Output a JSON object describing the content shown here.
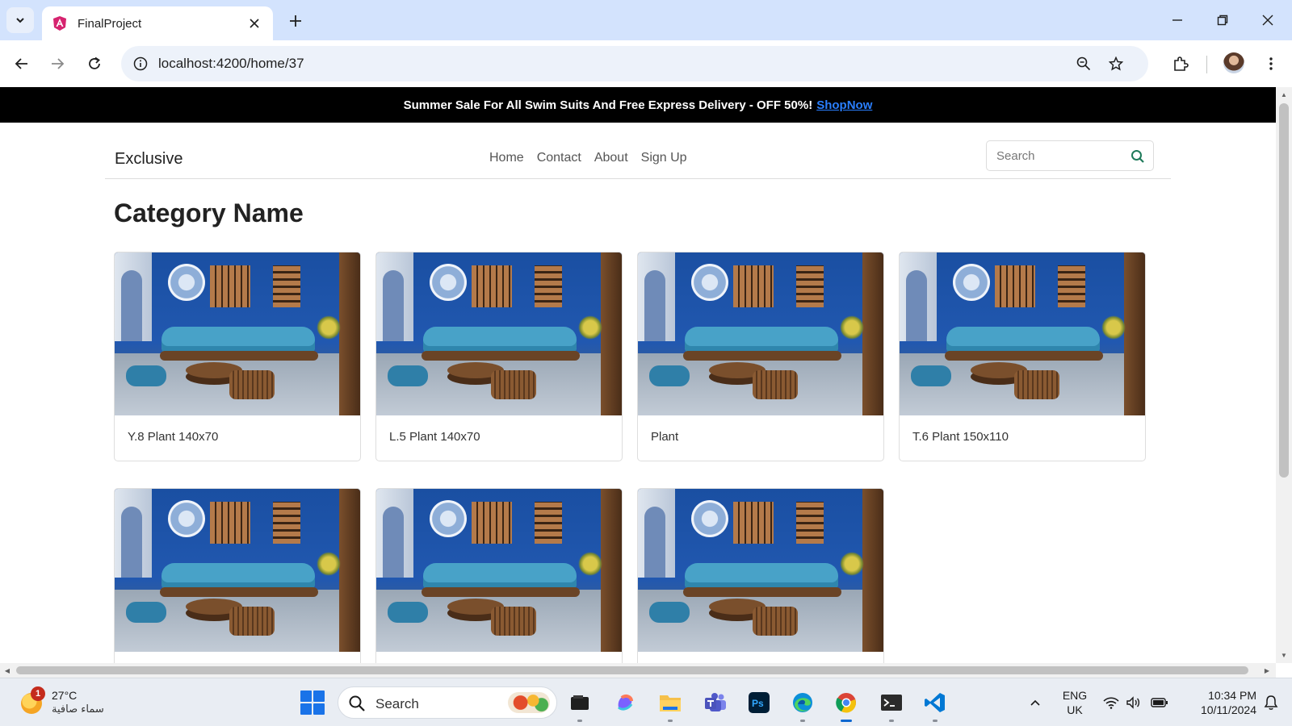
{
  "browser": {
    "tab_title": "FinalProject",
    "url": "localhost:4200/home/37"
  },
  "promo": {
    "text": "Summer Sale For All Swim Suits And Free Express Delivery - OFF 50%!",
    "link": "ShopNow"
  },
  "navbar": {
    "brand": "Exclusive",
    "links": [
      "Home",
      "Contact",
      "About",
      "Sign Up"
    ],
    "search_placeholder": "Search"
  },
  "page": {
    "title": "Category Name"
  },
  "products": [
    {
      "name": "Y.8 Plant 140x70"
    },
    {
      "name": "L.5 Plant 140x70"
    },
    {
      "name": "Plant"
    },
    {
      "name": "T.6 Plant 150x110"
    },
    {
      "name": ""
    },
    {
      "name": ""
    },
    {
      "name": ""
    }
  ],
  "taskbar": {
    "weather_temp": "27°C",
    "weather_desc": "سماء صافية",
    "weather_badge": "1",
    "search_label": "Search",
    "lang_line1": "ENG",
    "lang_line2": "UK",
    "time": "10:34 PM",
    "date": "10/11/2024",
    "apps": [
      "file-explorer-icon",
      "copilot-icon",
      "folder-icon",
      "teams-icon",
      "photoshop-icon",
      "edge-icon",
      "chrome-icon",
      "terminal-icon",
      "vscode-icon"
    ]
  },
  "colors": {
    "promo_bg": "#000000",
    "promo_link": "#2a7fff",
    "search_icon": "#1f7a5a",
    "tabstrip": "#d3e3fd"
  }
}
